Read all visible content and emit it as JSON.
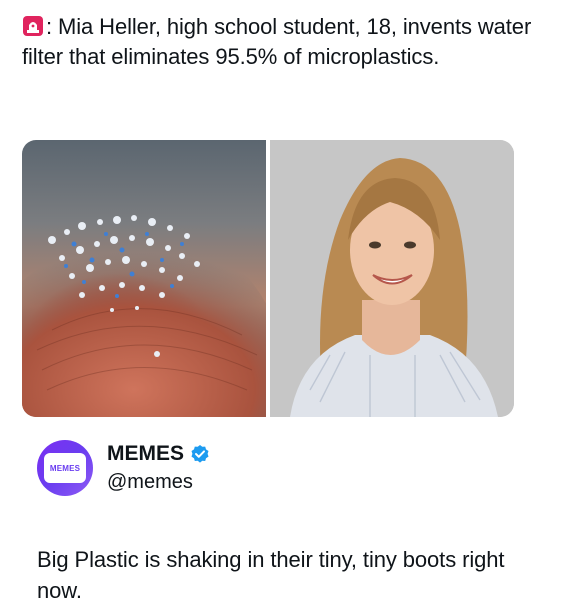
{
  "post": {
    "headline_text": ": Mia Heller, high school student, 18, invents water filter that eliminates 95.5% of microplastics.",
    "flag_icon": "red-siren-emoji",
    "media": [
      {
        "name": "microplastics-on-fingertip"
      },
      {
        "name": "portrait-of-student"
      }
    ]
  },
  "quote": {
    "display_name": "MEMES",
    "handle": "@memes",
    "avatar_text": "MEMES",
    "verified_color": "#1d9bf0",
    "text": "Big Plastic is shaking in their tiny, tiny boots right now."
  },
  "colors": {
    "accent_purple": "#6a3df0",
    "text": "#0f1419"
  }
}
